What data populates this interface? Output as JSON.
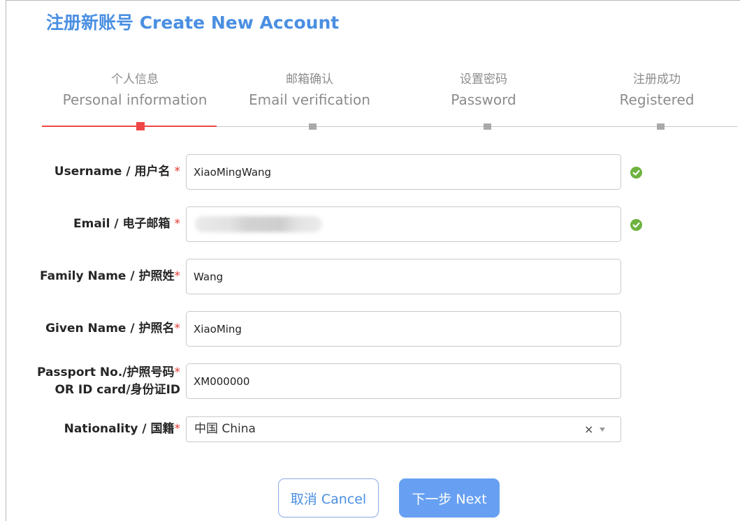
{
  "title": "注册新账号 Create New Account",
  "steps": {
    "current": 1,
    "items": [
      {
        "zh": "个人信息",
        "en": "Personal information"
      },
      {
        "zh": "邮箱确认",
        "en": "Email verification"
      },
      {
        "zh": "设置密码",
        "en": "Password"
      },
      {
        "zh": "注册成功",
        "en": "Registered"
      }
    ]
  },
  "form": {
    "username": {
      "label": "Username / 用户名",
      "required_mark": "*",
      "value": "XiaoMingWang",
      "status_icon": "check-circle-icon"
    },
    "email": {
      "label": "Email / 电子邮箱",
      "required_mark": "*",
      "value_obscured": true,
      "status_icon": "check-circle-icon"
    },
    "family_name": {
      "label": "Family Name / 护照姓",
      "required_mark": "*",
      "value": "Wang"
    },
    "given_name": {
      "label": "Given Name / 护照名",
      "required_mark": "*",
      "value": "XiaoMing"
    },
    "passport": {
      "label": "Passport No./护照号码",
      "required_mark": "*",
      "label_line2": "OR ID card/身份证ID",
      "value": "XM000000"
    },
    "nationality": {
      "label": "Nationality / 国籍",
      "required_mark": "*",
      "selected": "中国 China",
      "clear_glyph": "×",
      "dropdown_icon": "caret-down-icon"
    }
  },
  "buttons": {
    "cancel": "取消 Cancel",
    "next": "下一步 Next"
  },
  "colors": {
    "accent": "#4a8fe2",
    "step_active": "#f04646",
    "step_inactive": "#a9a9a9",
    "track": "#c8c8c8",
    "required": "#e53935",
    "valid": "#6db33f",
    "primary_button": "#67a0f2",
    "secondary_border": "#88aae6"
  }
}
